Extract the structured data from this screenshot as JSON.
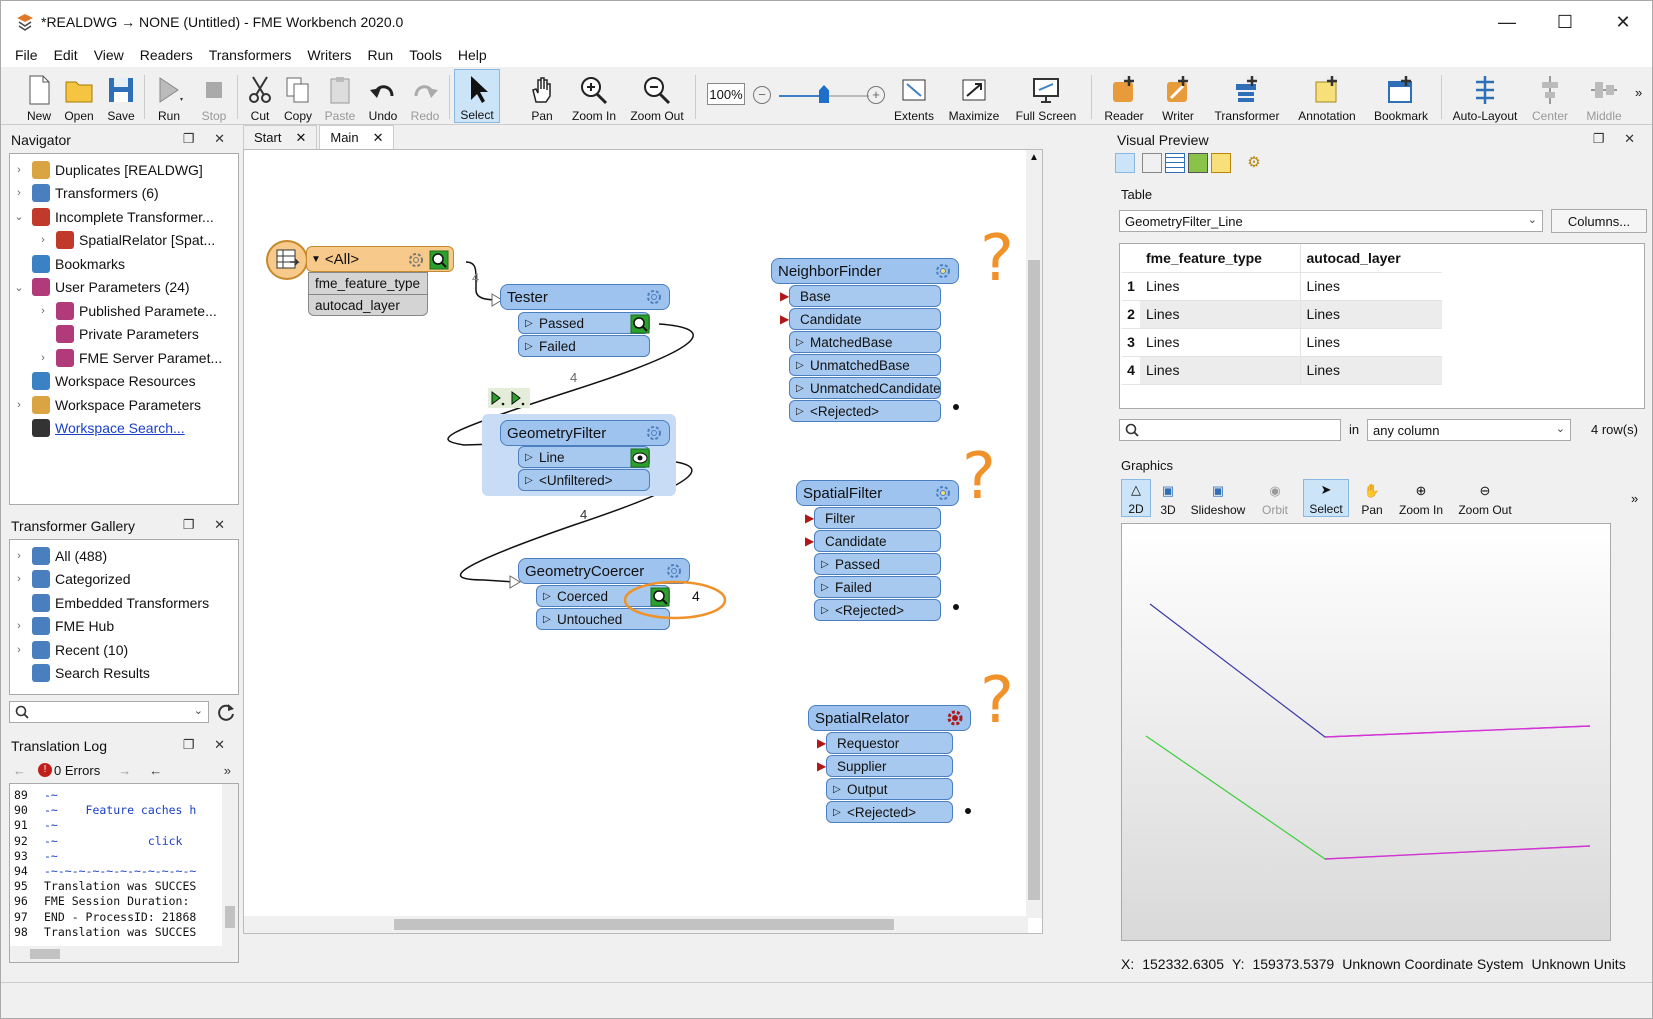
{
  "window": {
    "title": "*REALDWG → NONE (Untitled) - FME Workbench 2020.0"
  },
  "menu": [
    "File",
    "Edit",
    "View",
    "Readers",
    "Transformers",
    "Writers",
    "Run",
    "Tools",
    "Help"
  ],
  "toolbar": {
    "new": "New",
    "open": "Open",
    "save": "Save",
    "run": "Run",
    "stop": "Stop",
    "cut": "Cut",
    "copy": "Copy",
    "paste": "Paste",
    "undo": "Undo",
    "redo": "Redo",
    "select": "Select",
    "pan": "Pan",
    "zoom_in": "Zoom In",
    "zoom_out": "Zoom Out",
    "zoom_level": "100%",
    "zoom_slider_fraction": 0.5,
    "extents": "Extents",
    "maximize": "Maximize",
    "full_screen": "Full Screen",
    "reader": "Reader",
    "writer": "Writer",
    "transformer": "Transformer",
    "annotation": "Annotation",
    "bookmark": "Bookmark",
    "auto_layout": "Auto-Layout",
    "center": "Center",
    "middle": "Middle",
    "more": "»"
  },
  "navigator": {
    "title": "Navigator",
    "items": [
      {
        "label": "Duplicates [REALDWG]",
        "arrow": "›",
        "icon": "reader-icon",
        "color": "#d9a441"
      },
      {
        "label": "Transformers (6)",
        "arrow": "›",
        "icon": "transformer-icon",
        "color": "#4a7fbf"
      },
      {
        "label": "Incomplete Transformer...",
        "arrow": "⌄",
        "icon": "incomplete-transformer-icon",
        "color": "#c0392b"
      },
      {
        "label": "SpatialRelator [Spat...",
        "arrow": "›",
        "icon": "incomplete-transformer-icon",
        "color": "#c0392b"
      },
      {
        "label": "Bookmarks",
        "arrow": "",
        "icon": "bookmark-icon",
        "color": "#3b82c4"
      },
      {
        "label": "User Parameters (24)",
        "arrow": "⌄",
        "icon": "parameters-icon",
        "color": "#b03a7a"
      },
      {
        "label": "Published Paramete...",
        "arrow": "›",
        "icon": "parameters-icon",
        "color": "#b03a7a"
      },
      {
        "label": "Private Parameters",
        "arrow": "",
        "icon": "parameters-icon",
        "color": "#b03a7a"
      },
      {
        "label": "FME Server Paramet...",
        "arrow": "›",
        "icon": "parameters-icon",
        "color": "#b03a7a"
      },
      {
        "label": "Workspace Resources",
        "arrow": "",
        "icon": "resources-icon",
        "color": "#3b82c4"
      },
      {
        "label": "Workspace Parameters",
        "arrow": "›",
        "icon": "workspace-parameters-icon",
        "color": "#d9a441"
      },
      {
        "label": "Workspace Search...",
        "arrow": "",
        "icon": "search-icon",
        "color": "#333"
      }
    ]
  },
  "gallery": {
    "title": "Transformer Gallery",
    "items": [
      {
        "label": "All (488)",
        "arrow": "›",
        "icon": "transformer-icon"
      },
      {
        "label": "Categorized",
        "arrow": "›",
        "icon": "transformer-icon"
      },
      {
        "label": "Embedded Transformers",
        "arrow": "",
        "icon": "embedded-icon"
      },
      {
        "label": "FME Hub",
        "arrow": "›",
        "icon": "hub-icon"
      },
      {
        "label": "Recent (10)",
        "arrow": "›",
        "icon": "transformer-icon"
      },
      {
        "label": "Search Results",
        "arrow": "",
        "icon": "search-icon"
      }
    ]
  },
  "translation_log": {
    "title": "Translation Log",
    "errors": "0 Errors",
    "lines": [
      {
        "n": "89",
        "t": "-~",
        "c": "#1a3fc7"
      },
      {
        "n": "90",
        "t": "-~    Feature caches h",
        "c": "#1a3fc7"
      },
      {
        "n": "91",
        "t": "-~",
        "c": "#1a3fc7"
      },
      {
        "n": "92",
        "t": "-~             click",
        "c": "#1a3fc7"
      },
      {
        "n": "93",
        "t": "-~",
        "c": "#1a3fc7"
      },
      {
        "n": "94",
        "t": "-~-~-~-~-~-~-~-~-~-~-~",
        "c": "#1a3fc7"
      },
      {
        "n": "95",
        "t": "Translation was SUCCES",
        "c": "#111"
      },
      {
        "n": "96",
        "t": "FME Session Duration:",
        "c": "#111"
      },
      {
        "n": "97",
        "t": "END - ProcessID: 21868",
        "c": "#111"
      },
      {
        "n": "98",
        "t": "Translation was SUCCES",
        "c": "#111"
      }
    ]
  },
  "tabs": [
    {
      "label": "Start",
      "close": "✕"
    },
    {
      "label": "Main",
      "close": "✕"
    }
  ],
  "canvas": {
    "reader": {
      "name": "<All>",
      "attrs": [
        "fme_feature_type",
        "autocad_layer"
      ]
    },
    "tester": {
      "name": "Tester",
      "ports": [
        "Passed",
        "Failed"
      ]
    },
    "geometryfilter": {
      "name": "GeometryFilter",
      "ports": [
        "Line",
        "<Unfiltered>"
      ]
    },
    "geometrycoercer": {
      "name": "GeometryCoercer",
      "ports": [
        "Coerced",
        "Untouched"
      ]
    },
    "neighborfinder": {
      "name": "NeighborFinder",
      "inputs": [
        "Base",
        "Candidate"
      ],
      "ports": [
        "MatchedBase",
        "UnmatchedBase",
        "UnmatchedCandidate",
        "<Rejected>"
      ]
    },
    "spatialfilter": {
      "name": "SpatialFilter",
      "inputs": [
        "Filter",
        "Candidate"
      ],
      "ports": [
        "Passed",
        "Failed",
        "<Rejected>"
      ]
    },
    "spatialrelator": {
      "name": "SpatialRelator",
      "inputs": [
        "Requestor",
        "Supplier"
      ],
      "ports": [
        "Output",
        "<Rejected>"
      ]
    },
    "counts": {
      "reader_tester": "4",
      "tester_filter": "4",
      "filter_coercer": "4",
      "coerced": "4"
    },
    "annotation": "?"
  },
  "visual_preview": {
    "title": "Visual Preview",
    "table_label": "Table",
    "table_select": "GeometryFilter_Line",
    "columns_button": "Columns...",
    "columns": [
      "fme_feature_type",
      "autocad_layer"
    ],
    "rows": [
      {
        "n": "1",
        "a": "Lines",
        "b": "Lines"
      },
      {
        "n": "2",
        "a": "Lines",
        "b": "Lines"
      },
      {
        "n": "3",
        "a": "Lines",
        "b": "Lines"
      },
      {
        "n": "4",
        "a": "Lines",
        "b": "Lines"
      }
    ],
    "search_in": "in",
    "search_scope": "any column",
    "row_count": "4 row(s)",
    "graphics_label": "Graphics",
    "graphics_tools": [
      "2D",
      "3D",
      "Slideshow",
      "Orbit",
      "Select",
      "Pan",
      "Zoom In",
      "Zoom Out"
    ],
    "more": "»",
    "status": {
      "x_label": "X:",
      "x": "152332.6305",
      "y_label": "Y:",
      "y": "159373.5379",
      "crs": "Unknown Coordinate System",
      "units": "Unknown Units"
    }
  },
  "colors": {
    "accent": "#4c7fbf",
    "node": "#9ec3ee",
    "reader": "#f7c98a",
    "annotation": "#f0912a",
    "line_blue": "#3a3aa8",
    "line_green": "#3bcf3b",
    "line_magenta": "#d832d8"
  }
}
